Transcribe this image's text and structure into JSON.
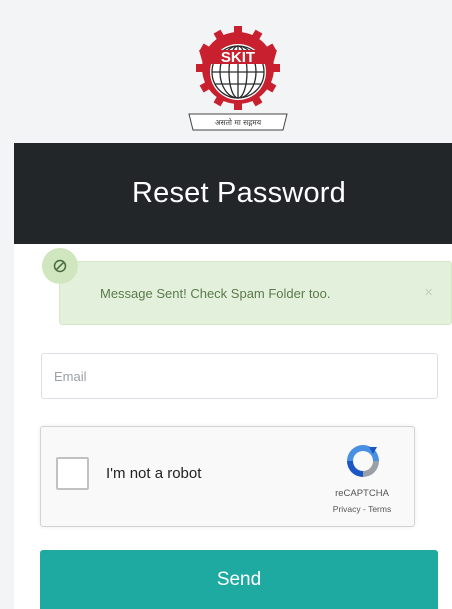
{
  "logo": {
    "text": "SKIT",
    "motto": "असतो मा सद्गमय"
  },
  "header": {
    "title": "Reset Password"
  },
  "alert": {
    "message": "Message Sent! Check Spam Folder too.",
    "close_label": "×",
    "icon": "ban-icon"
  },
  "form": {
    "email_placeholder": "Email"
  },
  "recaptcha": {
    "label": "I'm not a robot",
    "brand": "reCAPTCHA",
    "privacy": "Privacy",
    "separator": " - ",
    "terms": "Terms"
  },
  "send_label": "Send",
  "colors": {
    "header_bg": "#222629",
    "alert_bg": "#e3f1dc",
    "send_bg": "#1eaaa1",
    "logo_red": "#c8202f"
  }
}
